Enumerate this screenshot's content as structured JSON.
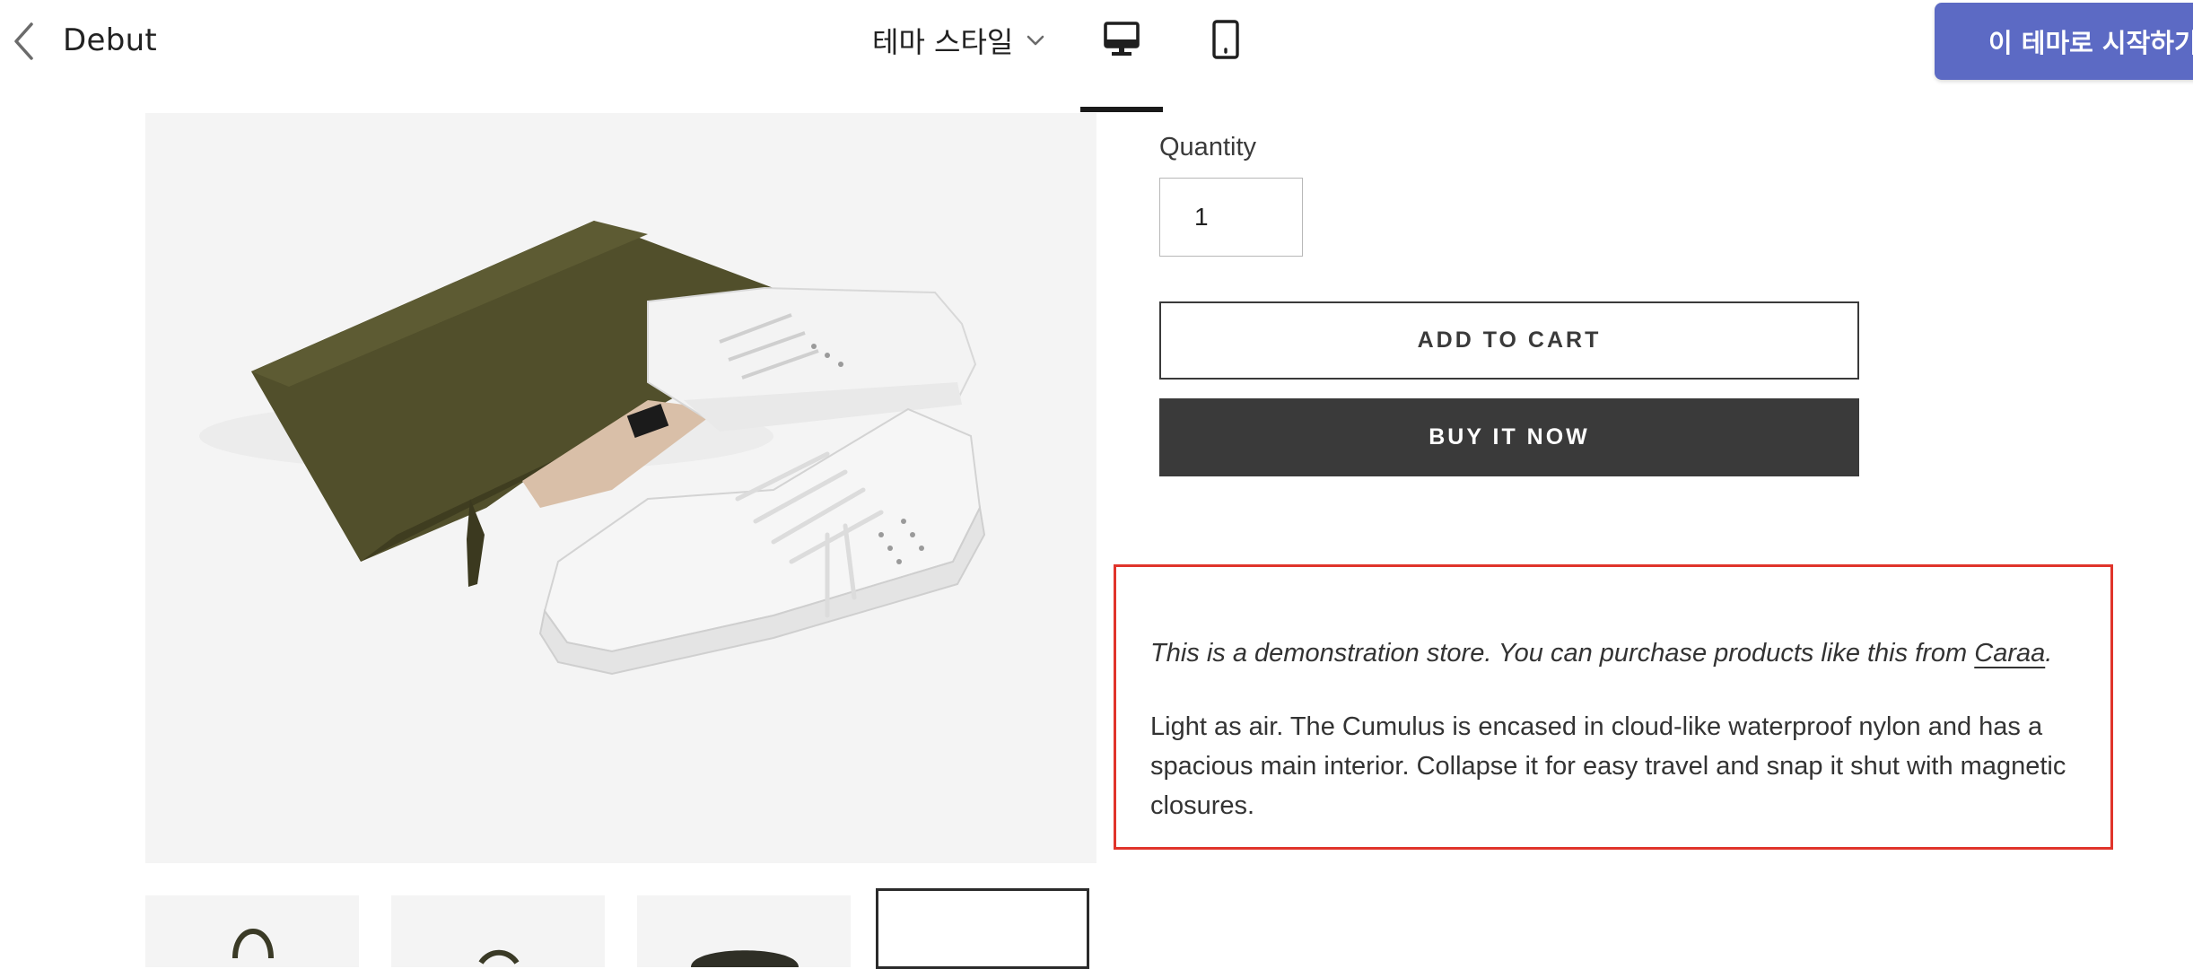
{
  "header": {
    "theme_name": "Debut",
    "style_selector_label": "테마 스타일",
    "start_button_label": "이 테마로 시작하기",
    "active_view": "desktop",
    "accent_color": "#5c6ac4"
  },
  "product": {
    "image_subject": "sneakers-and-pouch-photo",
    "thumbnails_active_index": 3,
    "quantity_label": "Quantity",
    "quantity_value": "1",
    "add_to_cart_label": "ADD TO CART",
    "buy_now_label": "BUY IT NOW",
    "description": {
      "demo_prefix": "This is a demonstration store. You can purchase products like this from ",
      "demo_link": "Caraa",
      "demo_suffix": ".",
      "body": "Light as air. The Cumulus is encased in cloud-like waterproof nylon and has a spacious main interior. Collapse it for easy travel and snap it shut with magnetic closures."
    },
    "highlight_color": "#e0342b"
  },
  "icons": {
    "back": "chevron-left-icon",
    "dropdown": "chevron-down-icon",
    "desktop": "desktop-icon",
    "mobile": "mobile-icon"
  }
}
